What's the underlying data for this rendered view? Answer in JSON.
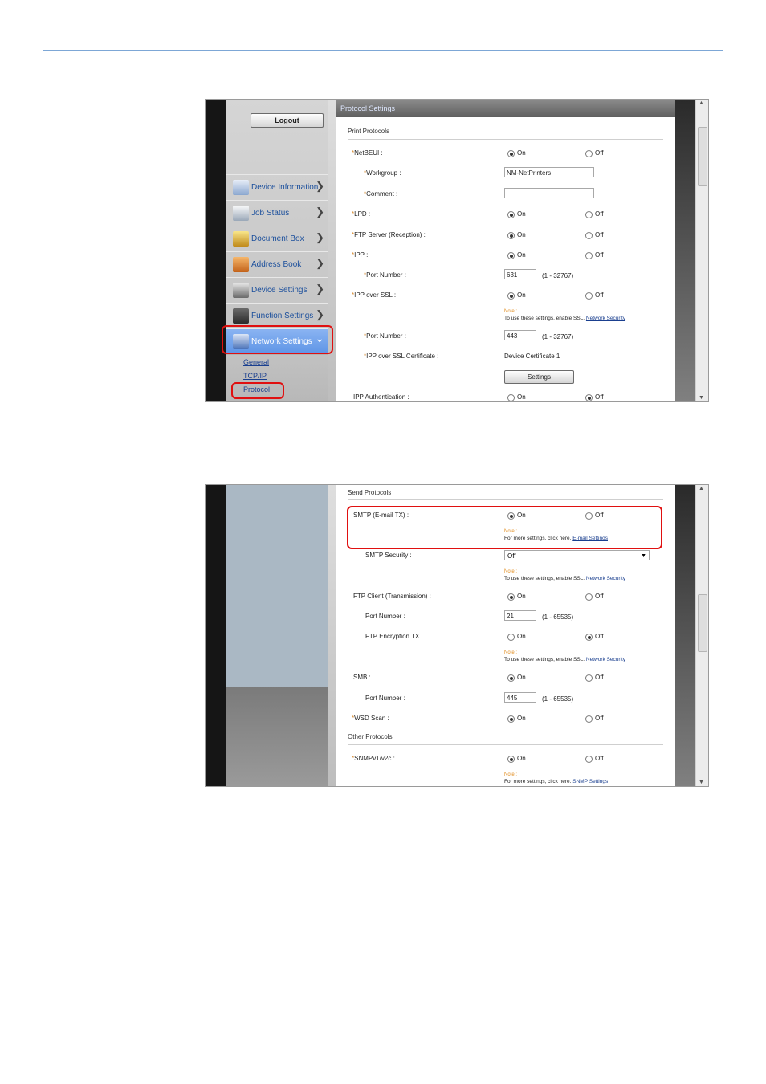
{
  "nav": {
    "logout": "Logout",
    "items": [
      {
        "label": "Device Information",
        "icon": "device-information-icon"
      },
      {
        "label": "Job Status",
        "icon": "job-status-icon"
      },
      {
        "label": "Document Box",
        "icon": "document-box-icon"
      },
      {
        "label": "Address Book",
        "icon": "address-book-icon"
      },
      {
        "label": "Device Settings",
        "icon": "device-settings-icon"
      },
      {
        "label": "Function Settings",
        "icon": "function-settings-icon"
      },
      {
        "label": "Network Settings",
        "icon": "network-settings-icon"
      }
    ],
    "sub": [
      "General",
      "TCP/IP",
      "Protocol"
    ]
  },
  "content1": {
    "header": "Protocol Settings",
    "section": "Print Protocols",
    "on": "On",
    "off": "Off",
    "netbeui": "NetBEUI :",
    "workgroup": "Workgroup :",
    "workgroup_value": "NM-NetPrinters",
    "comment": "Comment :",
    "lpd": "LPD :",
    "ftp_server": "FTP Server (Reception) :",
    "ipp": "IPP :",
    "port_number": "Port Number :",
    "ipp_port": "631",
    "port_range": "(1 - 32767)",
    "ipp_ssl": "IPP over SSL :",
    "note": "Note :",
    "ssl_note": "To use these settings, enable SSL.",
    "network_security": "Network Security",
    "ssl_port": "443",
    "ssl_cert": "IPP over SSL Certificate :",
    "cert_value": "Device Certificate 1",
    "settings_btn": "Settings",
    "ipp_auth": "IPP Authentication :"
  },
  "content2": {
    "send_section": "Send Protocols",
    "smtp": "SMTP (E-mail TX) :",
    "more_note": "For more settings, click here.",
    "email_settings": "E-mail Settings",
    "smtp_security": "SMTP Security :",
    "smtp_security_value": "Off",
    "ftp_client": "FTP Client (Transmission) :",
    "port_number": "Port Number :",
    "ftp_port": "21",
    "port_range": "(1 - 65535)",
    "ftp_enc": "FTP Encryption TX :",
    "smb": "SMB :",
    "smb_port": "445",
    "wsd": "WSD Scan :",
    "other_section": "Other Protocols",
    "snmp": "SNMPv1/v2c :",
    "snmp_settings": "SNMP Settings"
  },
  "colors": {
    "highlight": "#e01010",
    "nav_active": "#6a9ee9",
    "link": "#1a3f8f",
    "note": "#e08a1a"
  }
}
